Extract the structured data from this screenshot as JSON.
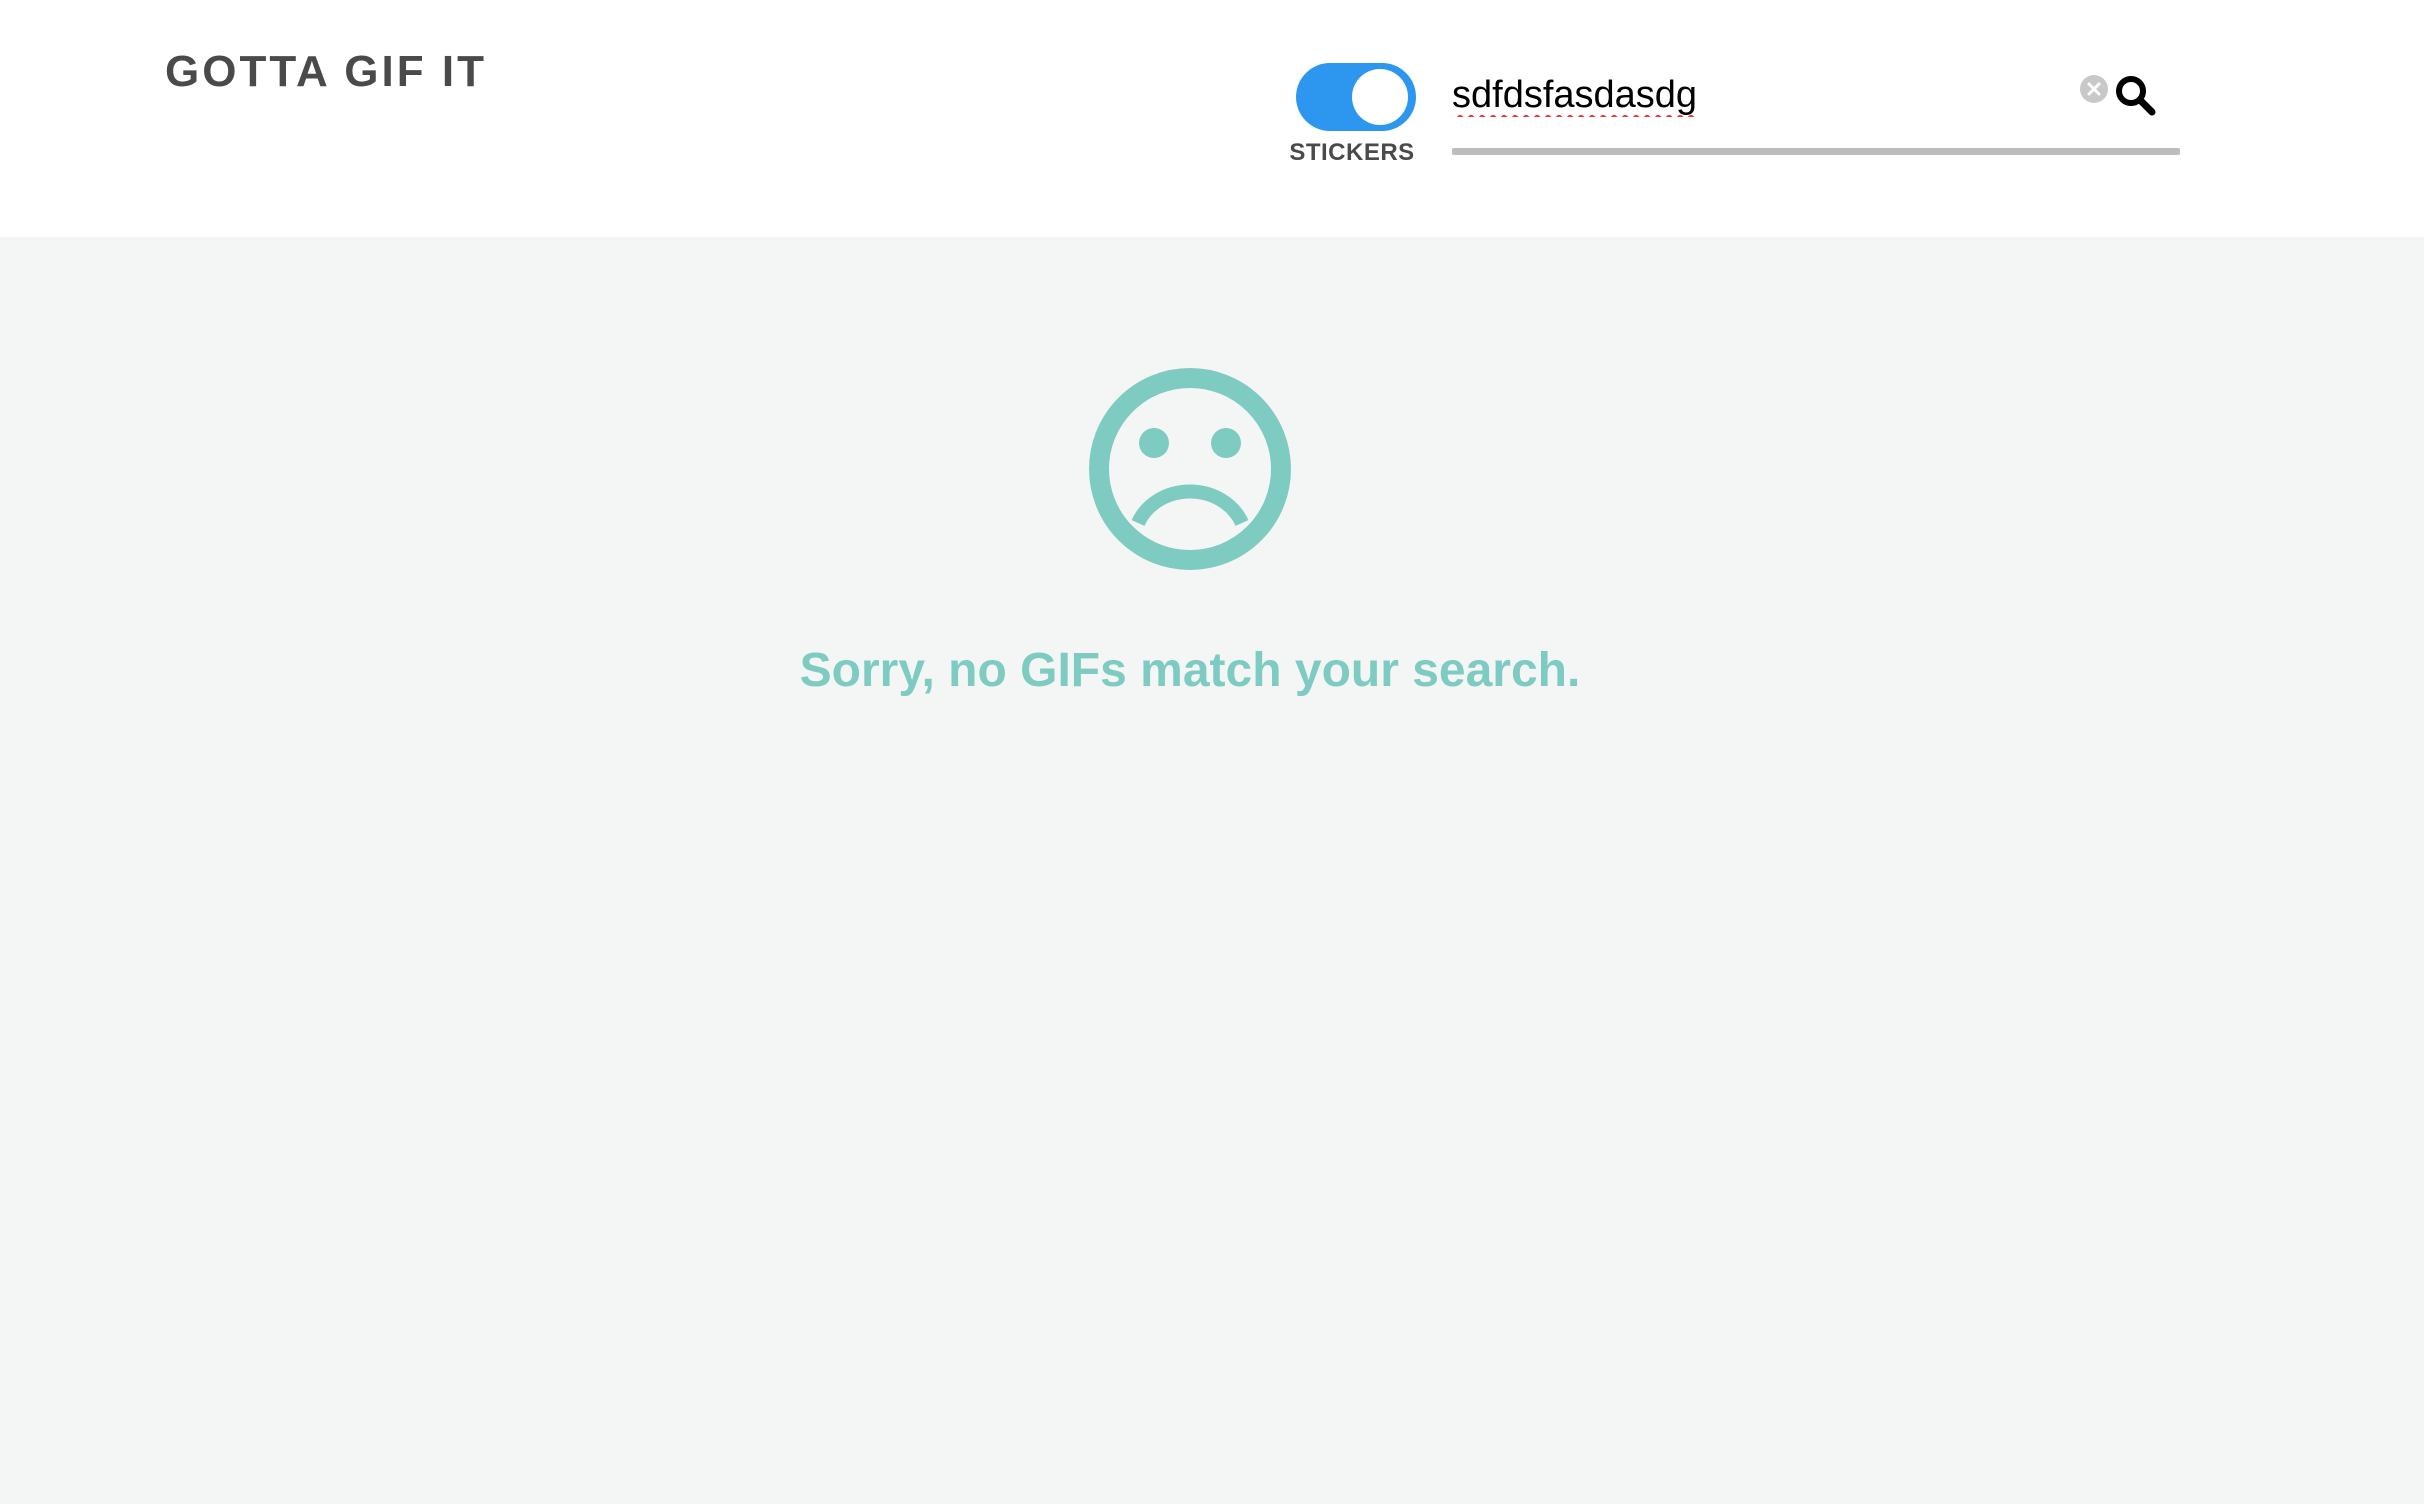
{
  "header": {
    "brand": "GOTTA GIF IT",
    "stickers_toggle": {
      "label": "STICKERS",
      "state": "on"
    },
    "search": {
      "value": "sdfdsfasdasdg",
      "placeholder": ""
    }
  },
  "empty_state": {
    "message": "Sorry, no GIFs match your search.",
    "icon": "sad-face-icon"
  },
  "colors": {
    "accent": "#2d96ef",
    "empty_state": "#7ecbc1",
    "brand_text": "#4a4a4a",
    "page_background": "#f4f6f5"
  },
  "icons": {
    "clear": "clear-icon",
    "search": "search-icon",
    "empty": "sad-face-icon"
  }
}
